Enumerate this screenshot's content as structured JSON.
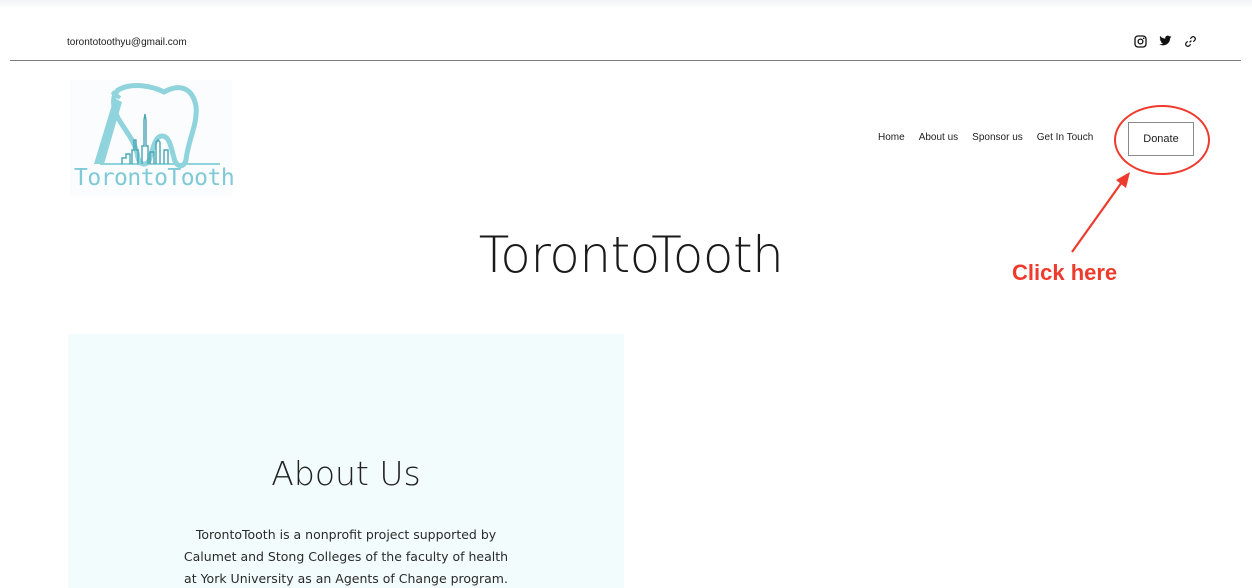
{
  "header": {
    "email": "torontotoothyu@gmail.com",
    "social_icons": [
      "instagram-icon",
      "twitter-icon",
      "link-icon"
    ]
  },
  "logo": {
    "text": "TorontoTooth",
    "color": "#7fcad6"
  },
  "nav": {
    "items": [
      "Home",
      "About us",
      "Sponsor us",
      "Get In Touch"
    ],
    "donate_label": "Donate"
  },
  "annotation": {
    "label": "Click here",
    "color": "#ee3b2d"
  },
  "hero": {
    "title": "TorontoTooth"
  },
  "about": {
    "title": "About Us",
    "body_lines": [
      "TorontoTooth is a nonprofit project supported by",
      "Calumet and Stong Colleges of the faculty of health",
      "at York University as an Agents of Change program."
    ],
    "panel_color": "#f3fcfd"
  }
}
